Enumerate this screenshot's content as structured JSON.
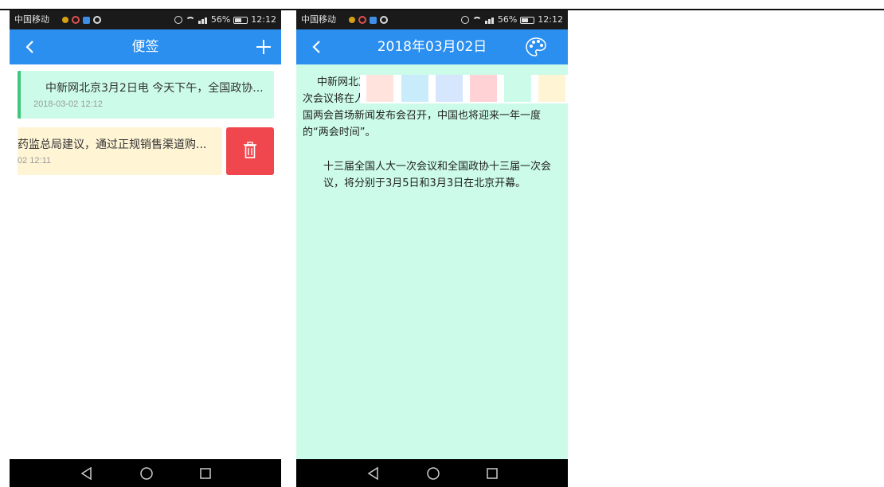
{
  "status_bar": {
    "carrier": "中国移动",
    "battery": "56%",
    "time": "12:12"
  },
  "list_screen": {
    "title": "便签",
    "notes": [
      {
        "text": "中新网北京3月2日电 今天下午，全国政协...",
        "date": "2018-03-02 12:12",
        "color": "#ccfce9",
        "accent": "#3cc77c"
      },
      {
        "text": "药监总局建议，通过正规销售渠道购...",
        "date": "02 12:11",
        "color": "#fff5d5"
      }
    ],
    "delete_color": "#f0464d"
  },
  "detail_screen": {
    "title": "2018年03月02日",
    "swatch_colors": [
      "#ffe3dc",
      "#c9ecfa",
      "#d6e6fd",
      "#ffd2d5",
      "#ccfce9",
      "#fff5d5"
    ],
    "body_line1_start": "中新网北京",
    "body_line2_start": "次会议将在人",
    "body_line3": "国两会首场新闻发布会召开，中国也将迎来一年一度",
    "body_line4": "的“两会时间”。",
    "body_para2": "十三届全国人大一次会议和全国政协十三届一次会议，将分别于3月5日和3月3日在北京开幕。",
    "background": "#ccfce9"
  },
  "icons": {
    "back": "chevron-left-icon",
    "add": "plus-icon",
    "palette": "palette-icon",
    "delete": "trash-icon",
    "nav_back": "triangle-back-icon",
    "nav_home": "circle-home-icon",
    "nav_recent": "square-recent-icon"
  },
  "accent": "#2b8ff0"
}
